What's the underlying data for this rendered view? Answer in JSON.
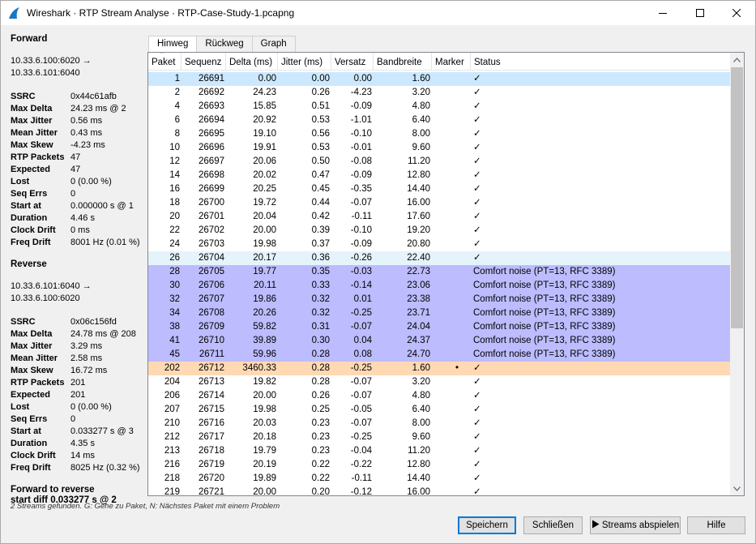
{
  "window": {
    "title": "Wireshark · RTP Stream Analyse · RTP-Case-Study-1.pcapng"
  },
  "forward": {
    "heading": "Forward",
    "addr_line1": "10.33.6.100:6020 →",
    "addr_line2": "10.33.6.101:6040",
    "stats": [
      {
        "k": "SSRC",
        "v": "0x44c61afb"
      },
      {
        "k": "Max Delta",
        "v": "24.23 ms @ 2"
      },
      {
        "k": "Max Jitter",
        "v": "0.56 ms"
      },
      {
        "k": "Mean Jitter",
        "v": "0.43 ms"
      },
      {
        "k": "Max Skew",
        "v": "-4.23 ms"
      },
      {
        "k": "RTP Packets",
        "v": "47"
      },
      {
        "k": "Expected",
        "v": "47"
      },
      {
        "k": "Lost",
        "v": "0 (0.00 %)"
      },
      {
        "k": "Seq Errs",
        "v": "0"
      },
      {
        "k": "Start at",
        "v": "0.000000 s @ 1"
      },
      {
        "k": "Duration",
        "v": "4.46 s"
      },
      {
        "k": "Clock Drift",
        "v": "0 ms"
      },
      {
        "k": "Freq Drift",
        "v": "8001 Hz (0.01 %)"
      }
    ]
  },
  "reverse": {
    "heading": "Reverse",
    "addr_line1": "10.33.6.101:6040 →",
    "addr_line2": "10.33.6.100:6020",
    "stats": [
      {
        "k": "SSRC",
        "v": "0x06c156fd"
      },
      {
        "k": "Max Delta",
        "v": "24.78 ms @ 208"
      },
      {
        "k": "Max Jitter",
        "v": "3.29 ms"
      },
      {
        "k": "Mean Jitter",
        "v": "2.58 ms"
      },
      {
        "k": "Max Skew",
        "v": "16.72 ms"
      },
      {
        "k": "RTP Packets",
        "v": "201"
      },
      {
        "k": "Expected",
        "v": "201"
      },
      {
        "k": "Lost",
        "v": "0 (0.00 %)"
      },
      {
        "k": "Seq Errs",
        "v": "0"
      },
      {
        "k": "Start at",
        "v": "0.033277 s @ 3"
      },
      {
        "k": "Duration",
        "v": "4.35 s"
      },
      {
        "k": "Clock Drift",
        "v": "14 ms"
      },
      {
        "k": "Freq Drift",
        "v": "8025 Hz (0.32 %)"
      }
    ]
  },
  "summary": {
    "line1": "Forward to reverse",
    "line2": "start diff 0.033277 s @ 2"
  },
  "tabs": [
    {
      "label": "Hinweg",
      "active": true
    },
    {
      "label": "Rückweg",
      "active": false
    },
    {
      "label": "Graph",
      "active": false
    }
  ],
  "table": {
    "columns": [
      "Paket",
      "Sequenz",
      "Delta (ms)",
      "Jitter (ms)",
      "Versatz",
      "Bandbreite",
      "Marker",
      "Status"
    ],
    "rows": [
      {
        "cells": [
          "1",
          "26691",
          "0.00",
          "0.00",
          "0.00",
          "1.60",
          "",
          "✓"
        ],
        "style": "sel"
      },
      {
        "cells": [
          "2",
          "26692",
          "24.23",
          "0.26",
          "-4.23",
          "3.20",
          "",
          "✓"
        ],
        "style": ""
      },
      {
        "cells": [
          "4",
          "26693",
          "15.85",
          "0.51",
          "-0.09",
          "4.80",
          "",
          "✓"
        ],
        "style": ""
      },
      {
        "cells": [
          "6",
          "26694",
          "20.92",
          "0.53",
          "-1.01",
          "6.40",
          "",
          "✓"
        ],
        "style": ""
      },
      {
        "cells": [
          "8",
          "26695",
          "19.10",
          "0.56",
          "-0.10",
          "8.00",
          "",
          "✓"
        ],
        "style": ""
      },
      {
        "cells": [
          "10",
          "26696",
          "19.91",
          "0.53",
          "-0.01",
          "9.60",
          "",
          "✓"
        ],
        "style": ""
      },
      {
        "cells": [
          "12",
          "26697",
          "20.06",
          "0.50",
          "-0.08",
          "11.20",
          "",
          "✓"
        ],
        "style": ""
      },
      {
        "cells": [
          "14",
          "26698",
          "20.02",
          "0.47",
          "-0.09",
          "12.80",
          "",
          "✓"
        ],
        "style": ""
      },
      {
        "cells": [
          "16",
          "26699",
          "20.25",
          "0.45",
          "-0.35",
          "14.40",
          "",
          "✓"
        ],
        "style": ""
      },
      {
        "cells": [
          "18",
          "26700",
          "19.72",
          "0.44",
          "-0.07",
          "16.00",
          "",
          "✓"
        ],
        "style": ""
      },
      {
        "cells": [
          "20",
          "26701",
          "20.04",
          "0.42",
          "-0.11",
          "17.60",
          "",
          "✓"
        ],
        "style": ""
      },
      {
        "cells": [
          "22",
          "26702",
          "20.00",
          "0.39",
          "-0.10",
          "19.20",
          "",
          "✓"
        ],
        "style": ""
      },
      {
        "cells": [
          "24",
          "26703",
          "19.98",
          "0.37",
          "-0.09",
          "20.80",
          "",
          "✓"
        ],
        "style": ""
      },
      {
        "cells": [
          "26",
          "26704",
          "20.17",
          "0.36",
          "-0.26",
          "22.40",
          "",
          "✓"
        ],
        "style": "light"
      },
      {
        "cells": [
          "28",
          "26705",
          "19.77",
          "0.35",
          "-0.03",
          "22.73",
          "",
          "Comfort noise (PT=13, RFC 3389)"
        ],
        "style": "cn"
      },
      {
        "cells": [
          "30",
          "26706",
          "20.11",
          "0.33",
          "-0.14",
          "23.06",
          "",
          "Comfort noise (PT=13, RFC 3389)"
        ],
        "style": "cn"
      },
      {
        "cells": [
          "32",
          "26707",
          "19.86",
          "0.32",
          "0.01",
          "23.38",
          "",
          "Comfort noise (PT=13, RFC 3389)"
        ],
        "style": "cn"
      },
      {
        "cells": [
          "34",
          "26708",
          "20.26",
          "0.32",
          "-0.25",
          "23.71",
          "",
          "Comfort noise (PT=13, RFC 3389)"
        ],
        "style": "cn"
      },
      {
        "cells": [
          "38",
          "26709",
          "59.82",
          "0.31",
          "-0.07",
          "24.04",
          "",
          "Comfort noise (PT=13, RFC 3389)"
        ],
        "style": "cn"
      },
      {
        "cells": [
          "41",
          "26710",
          "39.89",
          "0.30",
          "0.04",
          "24.37",
          "",
          "Comfort noise (PT=13, RFC 3389)"
        ],
        "style": "cn"
      },
      {
        "cells": [
          "45",
          "26711",
          "59.96",
          "0.28",
          "0.08",
          "24.70",
          "",
          "Comfort noise (PT=13, RFC 3389)"
        ],
        "style": "cn"
      },
      {
        "cells": [
          "202",
          "26712",
          "3460.33",
          "0.28",
          "-0.25",
          "1.60",
          "•",
          "✓"
        ],
        "style": "warn"
      },
      {
        "cells": [
          "204",
          "26713",
          "19.82",
          "0.28",
          "-0.07",
          "3.20",
          "",
          "✓"
        ],
        "style": ""
      },
      {
        "cells": [
          "206",
          "26714",
          "20.00",
          "0.26",
          "-0.07",
          "4.80",
          "",
          "✓"
        ],
        "style": ""
      },
      {
        "cells": [
          "207",
          "26715",
          "19.98",
          "0.25",
          "-0.05",
          "6.40",
          "",
          "✓"
        ],
        "style": ""
      },
      {
        "cells": [
          "210",
          "26716",
          "20.03",
          "0.23",
          "-0.07",
          "8.00",
          "",
          "✓"
        ],
        "style": ""
      },
      {
        "cells": [
          "212",
          "26717",
          "20.18",
          "0.23",
          "-0.25",
          "9.60",
          "",
          "✓"
        ],
        "style": ""
      },
      {
        "cells": [
          "213",
          "26718",
          "19.79",
          "0.23",
          "-0.04",
          "11.20",
          "",
          "✓"
        ],
        "style": ""
      },
      {
        "cells": [
          "216",
          "26719",
          "20.19",
          "0.22",
          "-0.22",
          "12.80",
          "",
          "✓"
        ],
        "style": ""
      },
      {
        "cells": [
          "218",
          "26720",
          "19.89",
          "0.22",
          "-0.11",
          "14.40",
          "",
          "✓"
        ],
        "style": ""
      },
      {
        "cells": [
          "219",
          "26721",
          "20.00",
          "0.20",
          "-0.12",
          "16.00",
          "",
          "✓"
        ],
        "style": ""
      }
    ]
  },
  "statusline": "2 Streams gefunden. G: Gehe zu Paket, N: Nächstes Paket mit einem Problem",
  "buttons": {
    "save": "Speichern",
    "close": "Schließen",
    "play": "Streams abspielen",
    "help": "Hilfe"
  },
  "colors": {
    "selected": "#cce8ff",
    "comfort_noise": "#bcbcff",
    "problem": "#ffd9b3",
    "accent": "#0078d7"
  }
}
